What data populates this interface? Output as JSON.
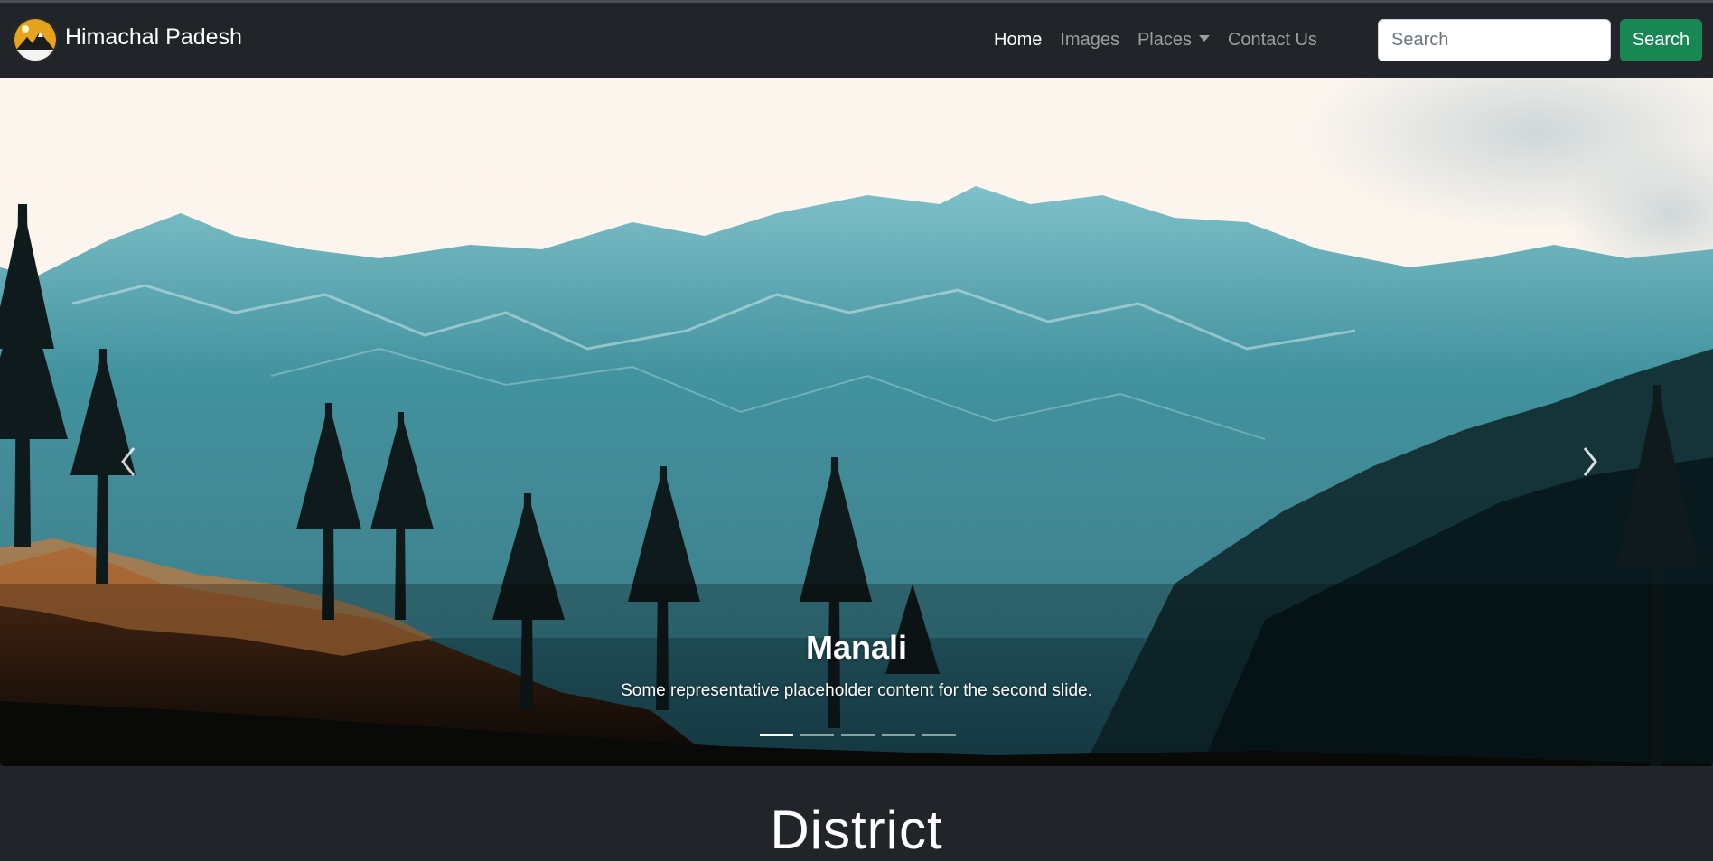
{
  "navbar": {
    "brand": "Himachal Padesh",
    "links": {
      "home": "Home",
      "images": "Images",
      "places": "Places",
      "contact": "Contact Us"
    },
    "search_placeholder": "Search",
    "search_button": "Search"
  },
  "carousel": {
    "slide_title": "Manali",
    "slide_text": "Some representative placeholder content for the second slide.",
    "indicator_count": 5,
    "active_indicator": 1
  },
  "section": {
    "heading": "District"
  },
  "icons": [
    "logo-icon",
    "caret-down-icon",
    "chevron-left-icon",
    "chevron-right-icon"
  ]
}
